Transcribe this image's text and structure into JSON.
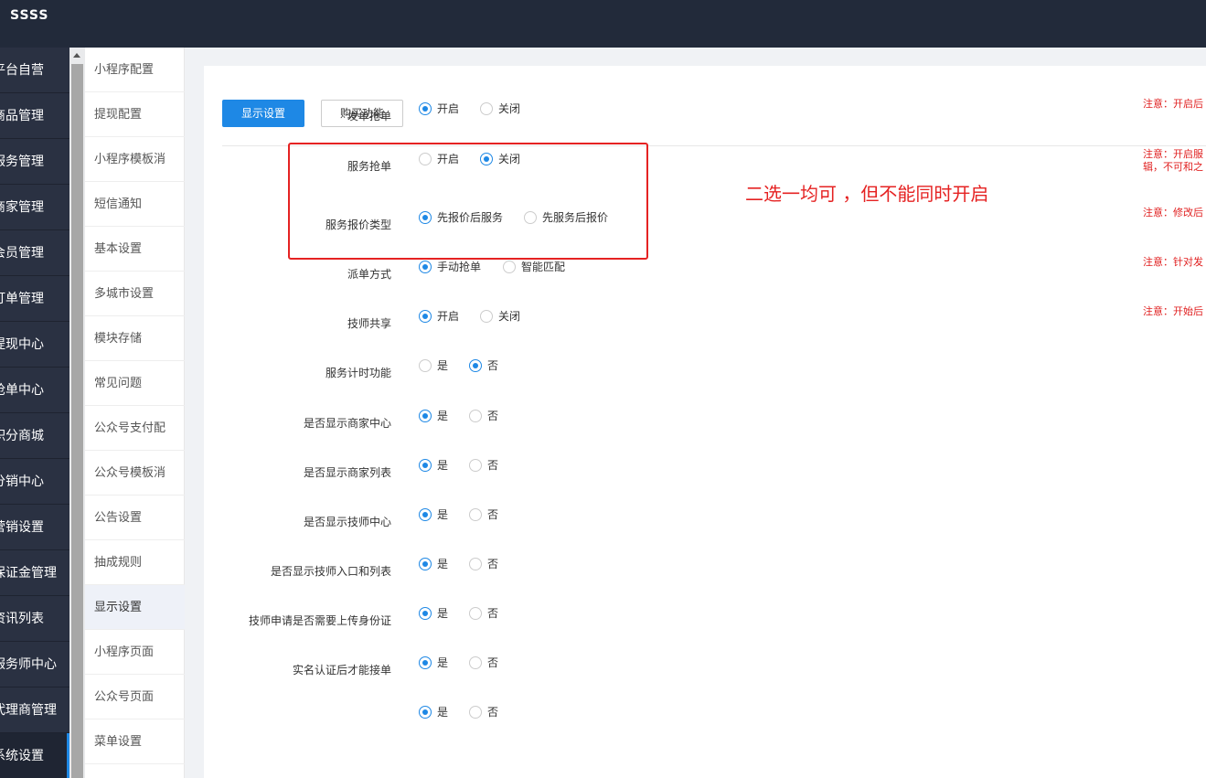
{
  "app": {
    "title": "SSSS"
  },
  "leftnav": {
    "items": [
      {
        "label": "平台自营"
      },
      {
        "label": "商品管理"
      },
      {
        "label": "服务管理"
      },
      {
        "label": "商家管理"
      },
      {
        "label": "会员管理"
      },
      {
        "label": "订单管理"
      },
      {
        "label": "提现中心"
      },
      {
        "label": "抢单中心"
      },
      {
        "label": "积分商城"
      },
      {
        "label": "分销中心"
      },
      {
        "label": "营销设置"
      },
      {
        "label": "保证金管理"
      },
      {
        "label": "资讯列表"
      },
      {
        "label": "服务师中心"
      },
      {
        "label": "代理商管理"
      },
      {
        "label": "系统设置"
      }
    ]
  },
  "subnav": {
    "items": [
      {
        "label": "小程序配置"
      },
      {
        "label": "提现配置"
      },
      {
        "label": "小程序模板消"
      },
      {
        "label": "短信通知"
      },
      {
        "label": "基本设置"
      },
      {
        "label": "多城市设置"
      },
      {
        "label": "模块存储"
      },
      {
        "label": "常见问题"
      },
      {
        "label": "公众号支付配"
      },
      {
        "label": "公众号模板消"
      },
      {
        "label": "公告设置"
      },
      {
        "label": "抽成规则"
      },
      {
        "label": "显示设置"
      },
      {
        "label": "小程序页面"
      },
      {
        "label": "公众号页面"
      },
      {
        "label": "菜单设置"
      }
    ]
  },
  "toolbar": {
    "primary_label": "显示设置",
    "secondary_label": "购买功能"
  },
  "annotation": "二选一均可 ，但不能同时开启",
  "settings": [
    {
      "label": "发单抢单",
      "options": [
        "开启",
        "关闭"
      ],
      "selected": 0,
      "note": "注意：开启后"
    },
    {
      "label": "服务抢单",
      "options": [
        "开启",
        "关闭"
      ],
      "selected": 1,
      "note": "注意：开启服",
      "note2": "辑，不可和之"
    },
    {
      "label": "服务报价类型",
      "options": [
        "先报价后服务",
        "先服务后报价"
      ],
      "selected": 0,
      "note": "注意：修改后"
    },
    {
      "label": "派单方式",
      "options": [
        "手动抢单",
        "智能匹配"
      ],
      "selected": 0,
      "note": "注意：针对发"
    },
    {
      "label": "技师共享",
      "options": [
        "开启",
        "关闭"
      ],
      "selected": 0,
      "note": "注意：开始后"
    },
    {
      "label": "服务计时功能",
      "options": [
        "是",
        "否"
      ],
      "selected": 1
    },
    {
      "label": "是否显示商家中心",
      "options": [
        "是",
        "否"
      ],
      "selected": 0
    },
    {
      "label": "是否显示商家列表",
      "options": [
        "是",
        "否"
      ],
      "selected": 0
    },
    {
      "label": "是否显示技师中心",
      "options": [
        "是",
        "否"
      ],
      "selected": 0
    },
    {
      "label": "是否显示技师入口和列表",
      "options": [
        "是",
        "否"
      ],
      "selected": 0
    },
    {
      "label": "技师申请是否需要上传身份证",
      "options": [
        "是",
        "否"
      ],
      "selected": 0
    },
    {
      "label": "实名认证后才能接单",
      "options": [
        "是",
        "否"
      ],
      "selected": 0
    },
    {
      "label": "",
      "options": [
        "是",
        "否"
      ],
      "selected": 0
    }
  ]
}
